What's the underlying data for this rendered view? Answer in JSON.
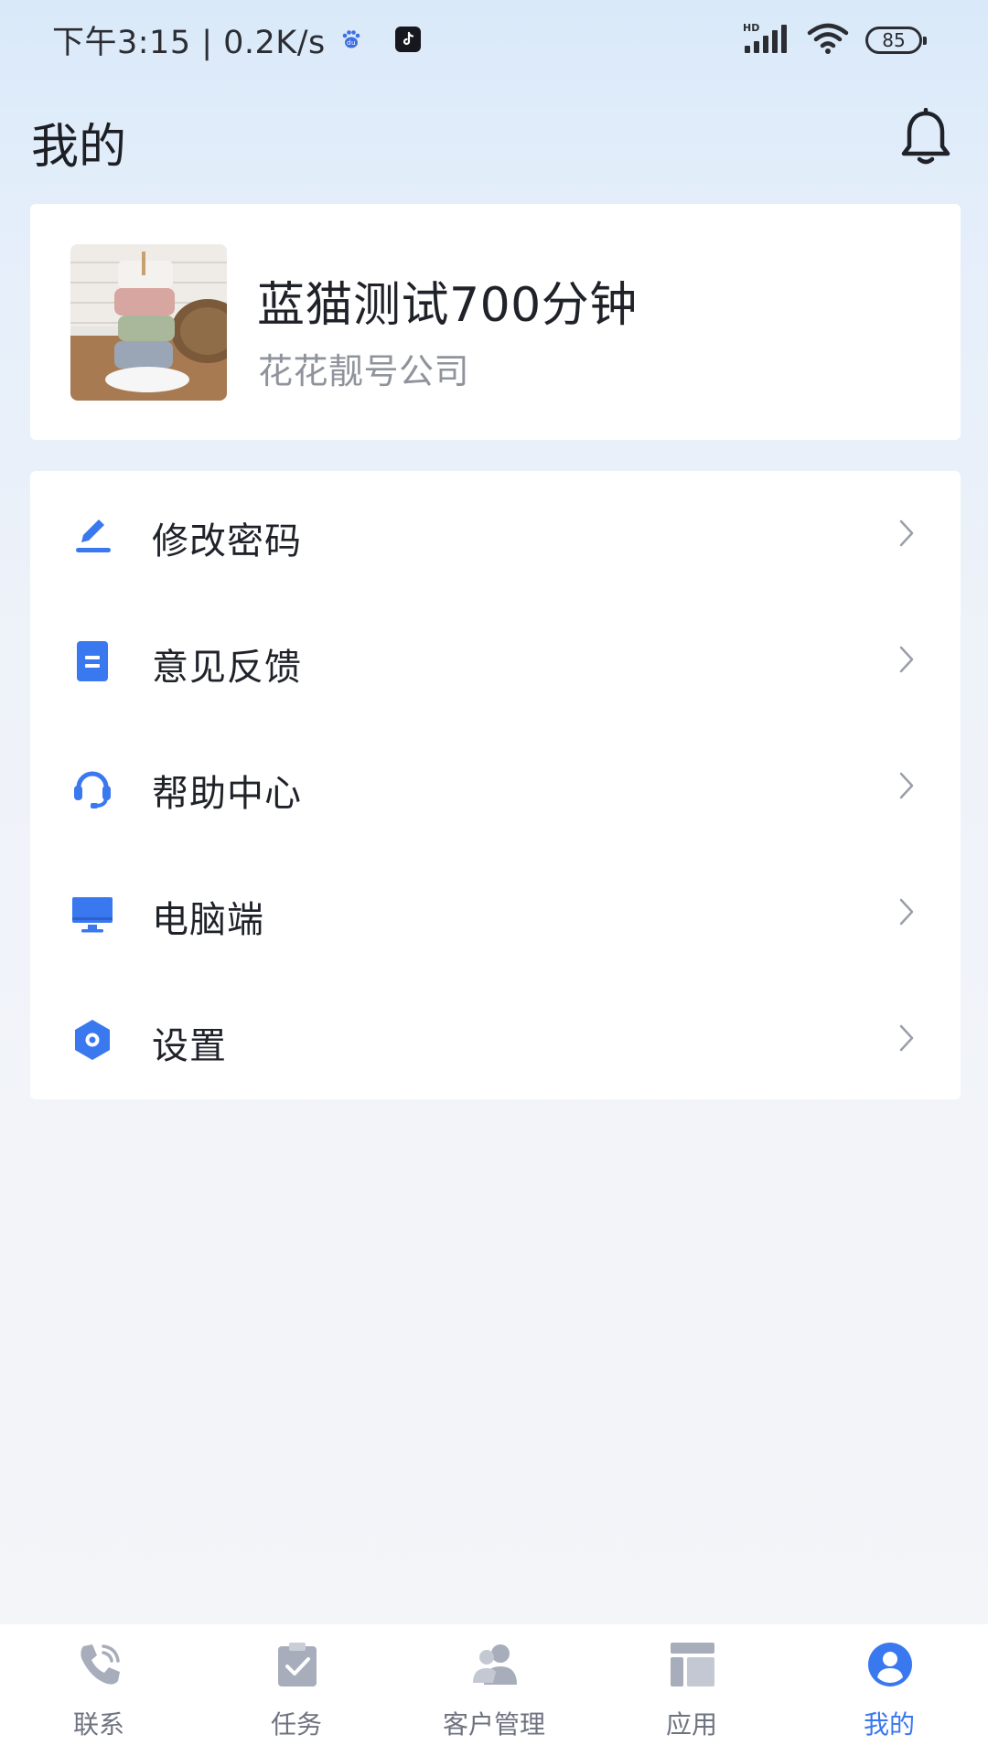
{
  "status_bar": {
    "time_speed": "下午3:15 | 0.2K/s",
    "network_label": "HD",
    "battery": "85"
  },
  "header": {
    "title": "我的"
  },
  "profile": {
    "name": "蓝猫测试700分钟",
    "company": "花花靓号公司"
  },
  "menu": {
    "items": [
      {
        "label": "修改密码",
        "icon": "edit-pencil-icon"
      },
      {
        "label": "意见反馈",
        "icon": "document-icon"
      },
      {
        "label": "帮助中心",
        "icon": "headset-icon"
      },
      {
        "label": "电脑端",
        "icon": "monitor-icon"
      },
      {
        "label": "设置",
        "icon": "hexagon-gear-icon"
      }
    ]
  },
  "bottom_nav": {
    "items": [
      {
        "label": "联系",
        "icon": "phone-icon",
        "active": false
      },
      {
        "label": "任务",
        "icon": "clipboard-check-icon",
        "active": false
      },
      {
        "label": "客户管理",
        "icon": "users-icon",
        "active": false
      },
      {
        "label": "应用",
        "icon": "apps-grid-icon",
        "active": false
      },
      {
        "label": "我的",
        "icon": "profile-icon",
        "active": true
      }
    ]
  },
  "colors": {
    "accent": "#3a78f0",
    "text_primary": "#1f2229",
    "text_secondary": "#8f939b",
    "nav_inactive": "#6e7380"
  }
}
